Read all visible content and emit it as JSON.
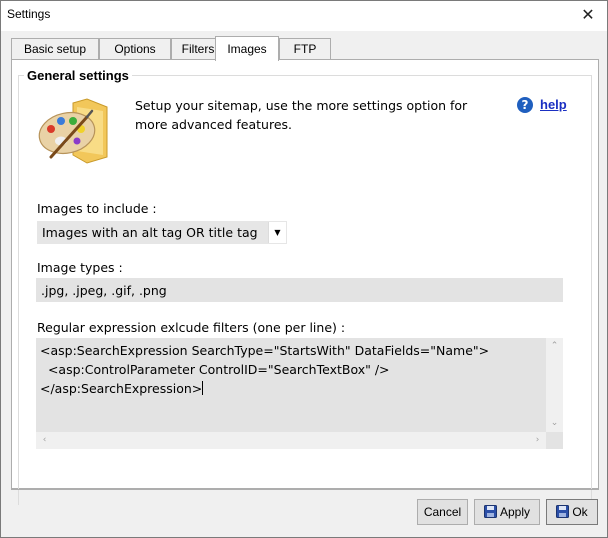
{
  "window": {
    "title": "Settings"
  },
  "tabs": [
    {
      "label": "Basic setup"
    },
    {
      "label": "Options"
    },
    {
      "label": "Filters"
    },
    {
      "label": "Images",
      "active": true
    },
    {
      "label": "FTP"
    }
  ],
  "group": {
    "title": "General settings",
    "intro_line1": "Setup your sitemap, use the more settings option for",
    "intro_line2": "more advanced features.",
    "help_label": "help"
  },
  "images_to_include": {
    "label": "Images to include :",
    "selected": "Images with an alt tag OR title tag"
  },
  "image_types": {
    "label": "Image types :",
    "value": ".jpg, .jpeg, .gif, .png"
  },
  "regex_filters": {
    "label": "Regular expression exlcude filters (one per line) :",
    "lines": [
      "<asp:SearchExpression SearchType=\"StartsWith\" DataFields=\"Name\">",
      "  <asp:ControlParameter ControlID=\"SearchTextBox\" />",
      "</asp:SearchExpression>"
    ]
  },
  "buttons": {
    "cancel": "Cancel",
    "apply": "Apply",
    "ok": "Ok"
  },
  "icons": {
    "palette": "palette-folder-icon",
    "help": "help-icon",
    "save": "floppy-disk-icon"
  },
  "colors": {
    "link": "#1a2fc2",
    "help_icon_bg": "#1f5fbf",
    "field_bg": "#e3e3e3"
  }
}
